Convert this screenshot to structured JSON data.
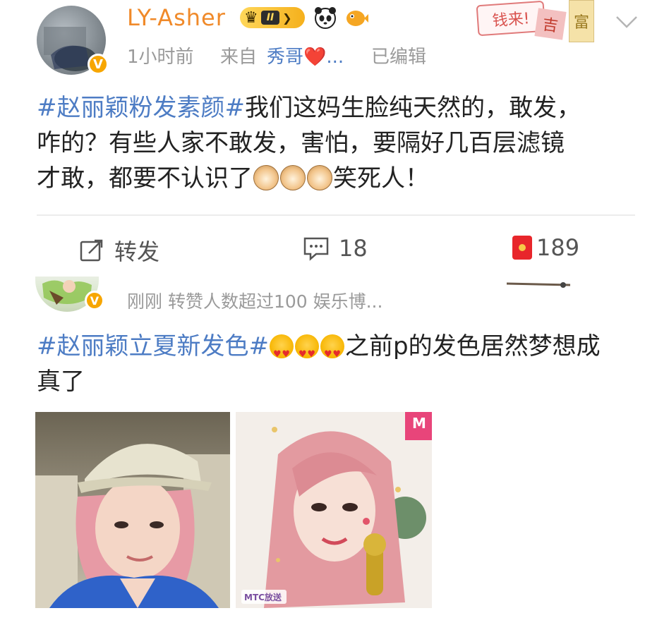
{
  "post1": {
    "username": "LY-Asher",
    "level_badge": "II",
    "time": "1小时前",
    "source_prefix": "来自",
    "source_name": "秀哥❤️...",
    "edited": "已编辑",
    "stamp_text": "钱来!",
    "stamp_tag1": "吉",
    "stamp_tag2": "富",
    "hashtag": "#赵丽颖粉发素颜#",
    "line1_rest": "我们这妈生脸纯天然的，敢发，",
    "line2": "咋的？有些人家不敢发，害怕，要隔好几百层滤镜",
    "line3_a": "才敢，都要不认识了",
    "line3_b": "笑死人！"
  },
  "actions": {
    "repost_label": "转发",
    "comment_count": "18",
    "like_count": "189"
  },
  "post2": {
    "meta": "刚刚  转赞人数超过100  娱乐博...",
    "hashtag": "#赵丽颖立夏新发色#",
    "line1_rest": "之前p的发色居然梦想成",
    "line2": "真了",
    "photo2_watermark": "MTC放送",
    "photo2_corner": "M"
  },
  "icons": {
    "crown": "crown-icon",
    "panda": "panda-icon",
    "pufferfish": "pufferfish-icon",
    "verified": "verified-badge-icon",
    "repost": "repost-icon",
    "comment": "comment-icon",
    "redpacket": "red-packet-icon",
    "chevron": "chevron-down-icon"
  },
  "colors": {
    "username": "#f08a2a",
    "hashtag": "#4d7cc4",
    "meta": "#9a9a9a",
    "verified": "#f7a600"
  }
}
